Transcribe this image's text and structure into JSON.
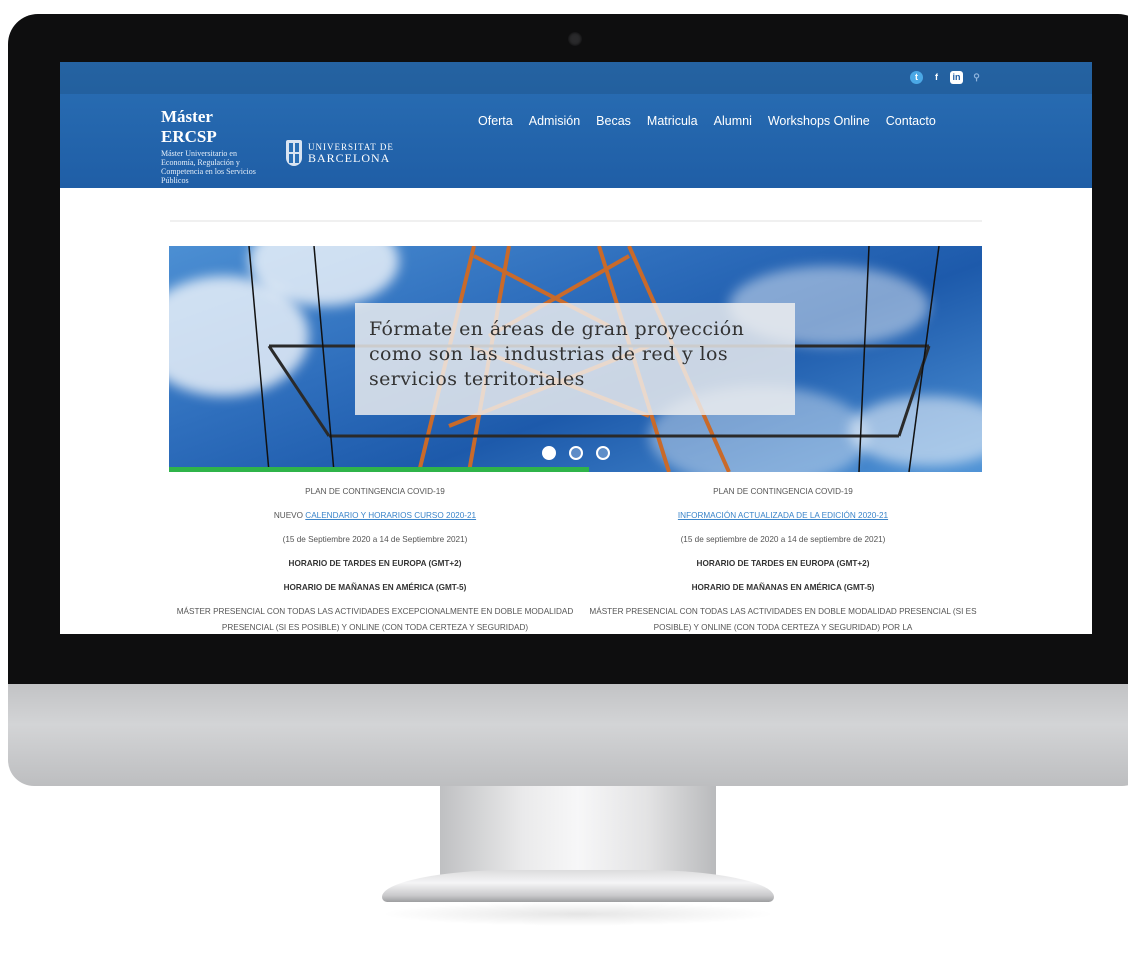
{
  "site": {
    "brand_title": "Máster ERCSP",
    "brand_subtitle": "Máster Universitario en Economía, Regulación y Competencia en los Servicios Públicos",
    "university_line1": "UNIVERSITAT DE",
    "university_line2": "BARCELONA",
    "social_icons": [
      "twitter-icon",
      "facebook-icon",
      "linkedin-icon",
      "search-icon"
    ]
  },
  "nav": {
    "items": [
      {
        "label": "Oferta"
      },
      {
        "label": "Admisión"
      },
      {
        "label": "Becas"
      },
      {
        "label": "Matricula"
      },
      {
        "label": "Alumni"
      },
      {
        "label": "Workshops Online"
      },
      {
        "label": "Contacto"
      }
    ]
  },
  "slider": {
    "caption": "Fórmate en áreas de gran proyección como son las industrias de red y los servicios territoriales",
    "slide_count": 3,
    "active_index": 0
  },
  "info_left": {
    "line1": "PLAN DE CONTINGENCIA COVID-19",
    "line2_prefix": "NUEVO ",
    "line2_link": "CALENDARIO Y HORARIOS CURSO 2020-21",
    "line3": "(15 de Septiembre 2020 a 14 de Septiembre 2021)",
    "line4": "HORARIO DE TARDES EN EUROPA (GMT+2)",
    "line5": "HORARIO DE MAÑANAS EN AMÉRICA (GMT-5)",
    "line6": "MÁSTER PRESENCIAL CON TODAS LAS ACTIVIDADES EXCEPCIONALMENTE EN DOBLE MODALIDAD PRESENCIAL (SI ES POSIBLE) Y ONLINE (CON TODA CERTEZA Y SEGURIDAD)"
  },
  "info_right": {
    "line1": "PLAN DE CONTINGENCIA COVID-19",
    "line2_link": "INFORMACIÓN ACTUALIZADA DE LA EDICIÓN 2020-21",
    "line3": "(15 de septiembre de 2020 a 14 de septiembre de 2021)",
    "line4": "HORARIO DE TARDES EN EUROPA (GMT+2)",
    "line5": "HORARIO DE MAÑANAS EN AMÉRICA (GMT-5)",
    "line6": "MÁSTER PRESENCIAL CON TODAS LAS ACTIVIDADES EN DOBLE MODALIDAD PRESENCIAL (SI ES POSIBLE) Y ONLINE (CON TODA CERTEZA Y SEGURIDAD) POR LA"
  },
  "colors": {
    "header_blue": "#1f5ea6",
    "link_blue": "#3a84c9",
    "accent_green": "#2fb44a"
  }
}
